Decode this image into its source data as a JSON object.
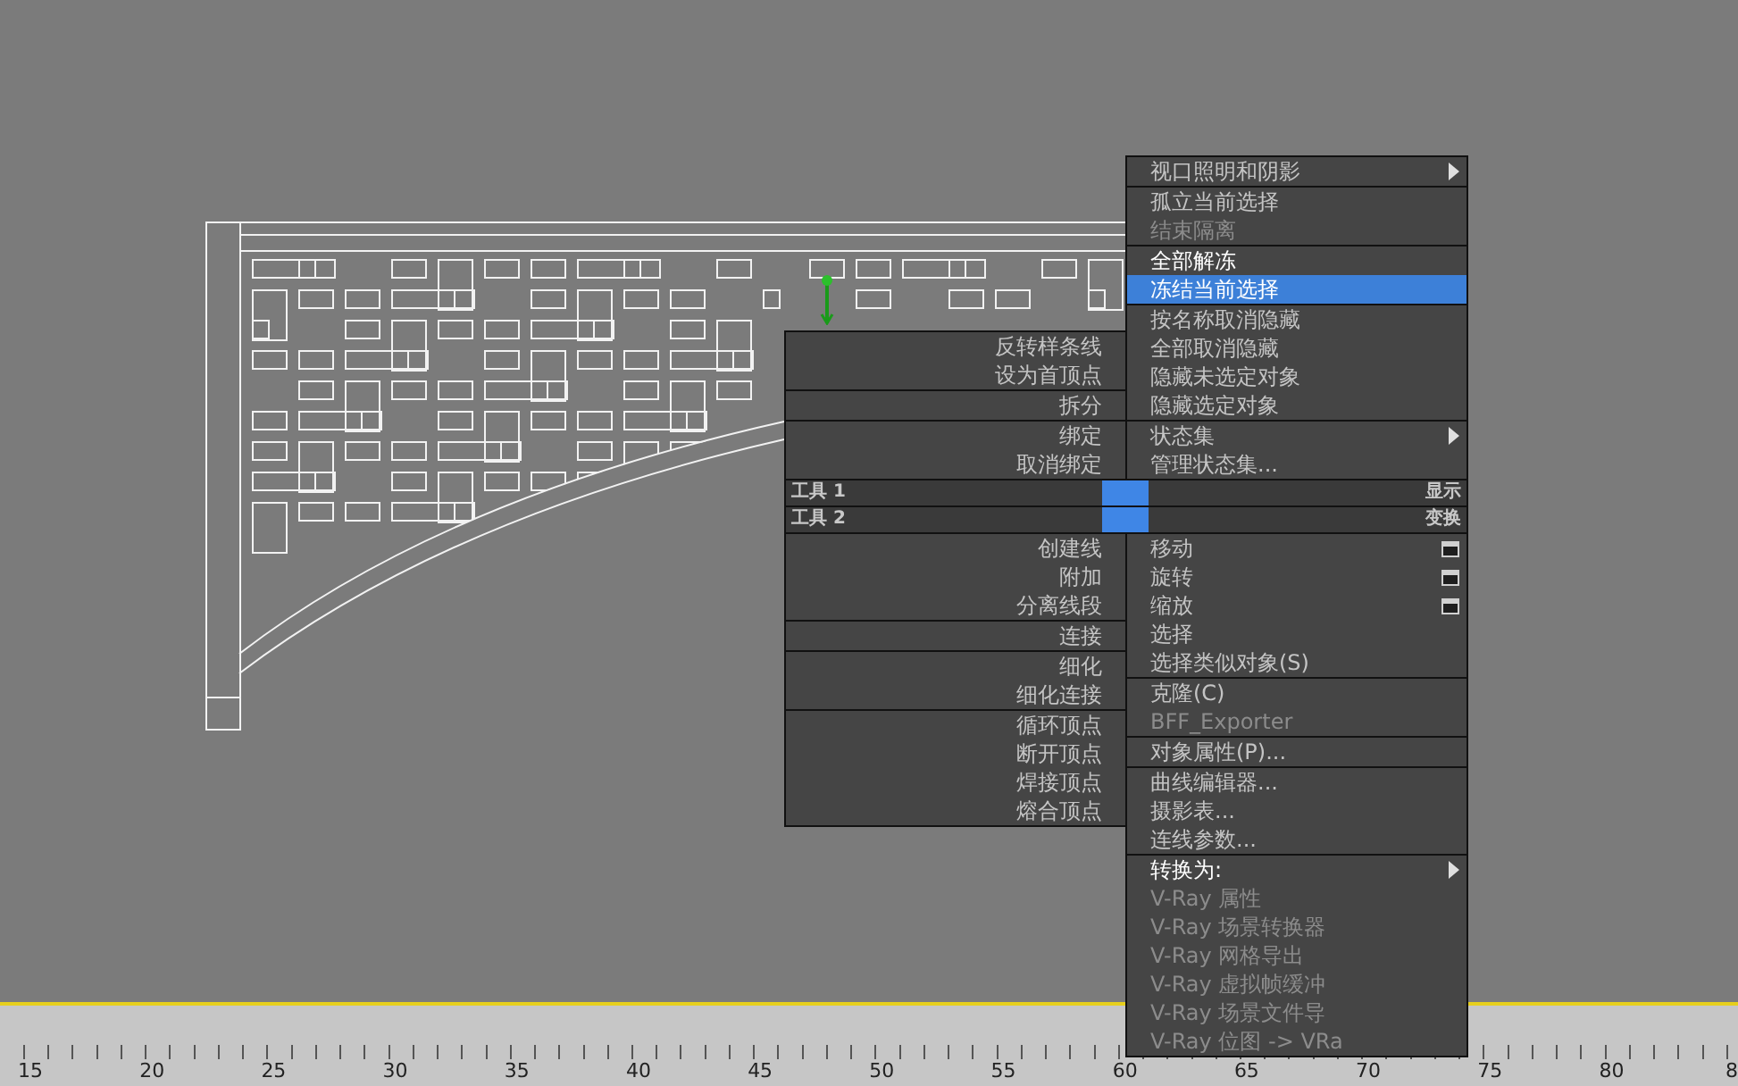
{
  "quad_menu": {
    "top_left": {
      "title": "工具 1",
      "groups": [
        {
          "items": [
            {
              "label": "反转样条线",
              "selected": false,
              "disabled": false,
              "emphasized": false
            },
            {
              "label": "设为首顶点",
              "selected": false,
              "disabled": false,
              "emphasized": false
            }
          ]
        },
        {
          "items": [
            {
              "label": "拆分",
              "selected": false,
              "disabled": false,
              "emphasized": false
            }
          ]
        },
        {
          "items": [
            {
              "label": "绑定",
              "selected": false,
              "disabled": false,
              "emphasized": false
            },
            {
              "label": "取消绑定",
              "selected": false,
              "disabled": false,
              "emphasized": false
            }
          ]
        }
      ]
    },
    "top_right": {
      "title": "显示",
      "groups": [
        {
          "items": [
            {
              "label": "视口照明和阴影",
              "kind": "submenu",
              "selected": false,
              "disabled": false,
              "emphasized": false
            }
          ]
        },
        {
          "items": [
            {
              "label": "孤立当前选择",
              "kind": "plain",
              "selected": false,
              "disabled": false,
              "emphasized": false
            },
            {
              "label": "结束隔离",
              "kind": "plain",
              "selected": false,
              "disabled": true,
              "emphasized": false
            }
          ]
        },
        {
          "items": [
            {
              "label": "全部解冻",
              "kind": "plain",
              "selected": false,
              "disabled": false,
              "emphasized": true
            },
            {
              "label": "冻结当前选择",
              "kind": "plain",
              "selected": true,
              "disabled": false,
              "emphasized": false
            }
          ]
        },
        {
          "items": [
            {
              "label": "按名称取消隐藏",
              "kind": "plain",
              "selected": false,
              "disabled": false,
              "emphasized": false
            },
            {
              "label": "全部取消隐藏",
              "kind": "plain",
              "selected": false,
              "disabled": false,
              "emphasized": false
            },
            {
              "label": "隐藏未选定对象",
              "kind": "plain",
              "selected": false,
              "disabled": false,
              "emphasized": false
            },
            {
              "label": "隐藏选定对象",
              "kind": "plain",
              "selected": false,
              "disabled": false,
              "emphasized": false
            }
          ]
        },
        {
          "items": [
            {
              "label": "状态集",
              "kind": "submenu",
              "selected": false,
              "disabled": false,
              "emphasized": false
            },
            {
              "label": "管理状态集...",
              "kind": "plain",
              "selected": false,
              "disabled": false,
              "emphasized": false
            }
          ]
        }
      ]
    },
    "bottom_left": {
      "title": "工具 2",
      "groups": [
        {
          "items": [
            {
              "label": "创建线",
              "selected": false,
              "disabled": false,
              "emphasized": false
            },
            {
              "label": "附加",
              "selected": false,
              "disabled": false,
              "emphasized": false
            },
            {
              "label": "分离线段",
              "selected": false,
              "disabled": false,
              "emphasized": false
            }
          ]
        },
        {
          "items": [
            {
              "label": "连接",
              "selected": false,
              "disabled": false,
              "emphasized": false
            }
          ]
        },
        {
          "items": [
            {
              "label": "细化",
              "selected": false,
              "disabled": false,
              "emphasized": false
            },
            {
              "label": "细化连接",
              "selected": false,
              "disabled": false,
              "emphasized": false
            }
          ]
        },
        {
          "items": [
            {
              "label": "循环顶点",
              "selected": false,
              "disabled": false,
              "emphasized": false
            },
            {
              "label": "断开顶点",
              "selected": false,
              "disabled": false,
              "emphasized": false
            },
            {
              "label": "焊接顶点",
              "selected": false,
              "disabled": false,
              "emphasized": false
            },
            {
              "label": "熔合顶点",
              "selected": false,
              "disabled": false,
              "emphasized": false
            }
          ]
        }
      ]
    },
    "bottom_right": {
      "title": "变换",
      "groups": [
        {
          "items": [
            {
              "label": "移动",
              "kind": "option",
              "selected": false,
              "disabled": false,
              "emphasized": false
            },
            {
              "label": "旋转",
              "kind": "option",
              "selected": false,
              "disabled": false,
              "emphasized": false
            },
            {
              "label": "缩放",
              "kind": "option",
              "selected": false,
              "disabled": false,
              "emphasized": false
            },
            {
              "label": "选择",
              "kind": "plain",
              "selected": false,
              "disabled": false,
              "emphasized": false
            },
            {
              "label": "选择类似对象(S)",
              "kind": "plain",
              "selected": false,
              "disabled": false,
              "emphasized": false
            }
          ]
        },
        {
          "items": [
            {
              "label": "克隆(C)",
              "kind": "plain",
              "selected": false,
              "disabled": false,
              "emphasized": false
            },
            {
              "label": "BFF_Exporter",
              "kind": "plain",
              "selected": false,
              "disabled": true,
              "emphasized": false
            }
          ]
        },
        {
          "items": [
            {
              "label": "对象属性(P)...",
              "kind": "plain",
              "selected": false,
              "disabled": false,
              "emphasized": false
            }
          ]
        },
        {
          "items": [
            {
              "label": "曲线编辑器...",
              "kind": "plain",
              "selected": false,
              "disabled": false,
              "emphasized": false
            },
            {
              "label": "摄影表...",
              "kind": "plain",
              "selected": false,
              "disabled": false,
              "emphasized": false
            },
            {
              "label": "连线参数...",
              "kind": "plain",
              "selected": false,
              "disabled": false,
              "emphasized": false
            }
          ]
        },
        {
          "items": [
            {
              "label": "转换为:",
              "kind": "submenu",
              "selected": false,
              "disabled": false,
              "emphasized": true
            },
            {
              "label": "V-Ray 属性",
              "kind": "plain",
              "selected": false,
              "disabled": true,
              "emphasized": false
            },
            {
              "label": "V-Ray 场景转换器",
              "kind": "plain",
              "selected": false,
              "disabled": true,
              "emphasized": false
            },
            {
              "label": "V-Ray 网格导出",
              "kind": "plain",
              "selected": false,
              "disabled": true,
              "emphasized": false
            },
            {
              "label": "V-Ray 虚拟帧缓冲",
              "kind": "plain",
              "selected": false,
              "disabled": true,
              "emphasized": false
            },
            {
              "label": "V-Ray 场景文件导",
              "kind": "plain",
              "selected": false,
              "disabled": true,
              "emphasized": false
            },
            {
              "label": "V-Ray 位图 -> VRa",
              "kind": "plain",
              "selected": false,
              "disabled": true,
              "emphasized": false
            }
          ]
        }
      ]
    }
  },
  "timeline": {
    "labels": [
      "15",
      "20",
      "25",
      "30",
      "35",
      "40",
      "45",
      "50",
      "55",
      "60",
      "65",
      "70",
      "75",
      "80",
      "8"
    ]
  }
}
